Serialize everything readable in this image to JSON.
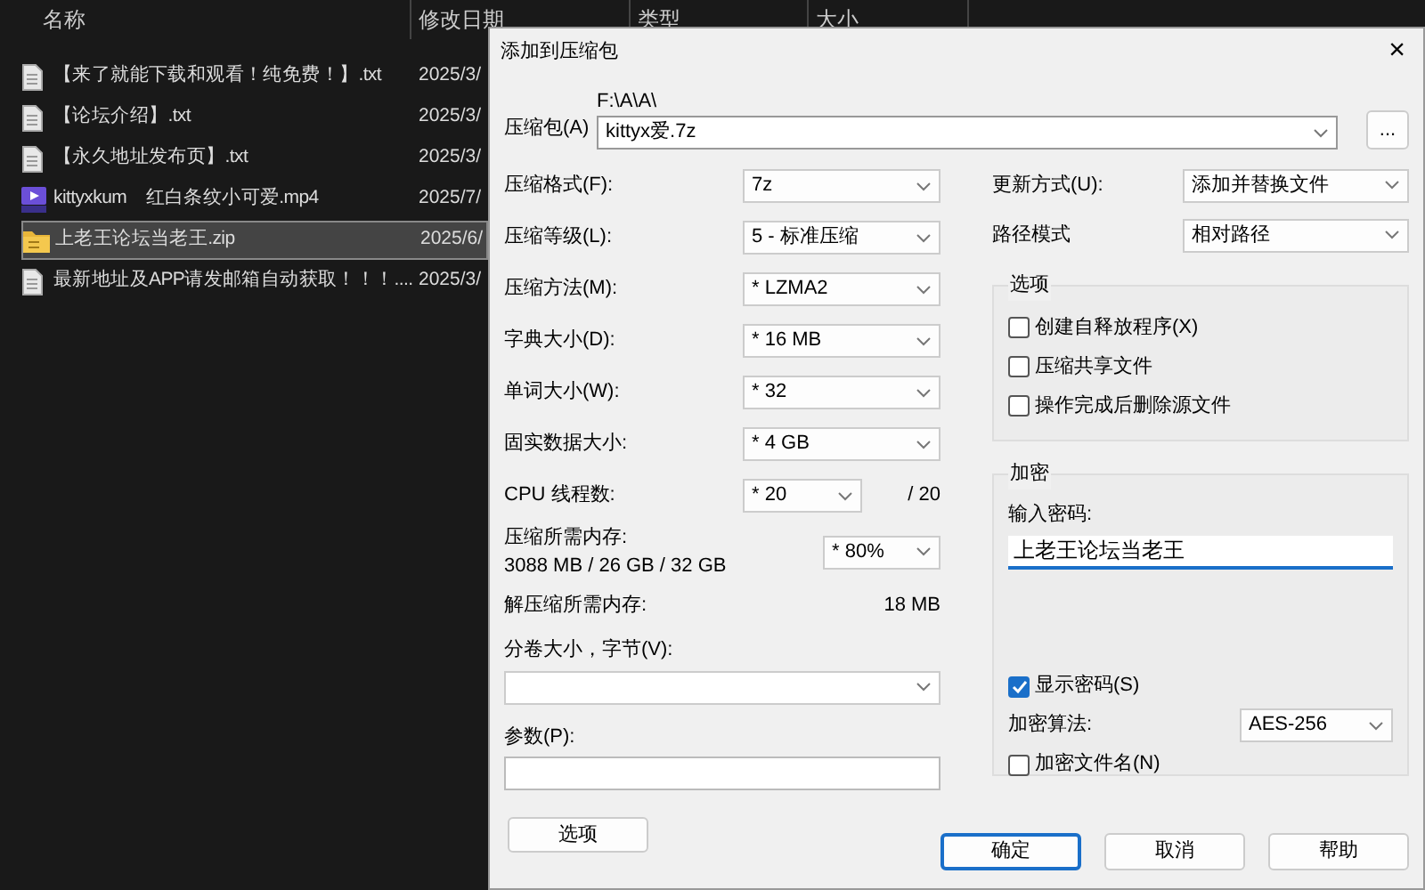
{
  "explorer": {
    "columns": [
      "名称",
      "修改日期",
      "类型",
      "大小"
    ],
    "files": [
      {
        "name": "【来了就能下载和观看！纯免费！】.txt",
        "date": "2025/3/",
        "kind": "text",
        "selected": false
      },
      {
        "name": "【论坛介绍】.txt",
        "date": "2025/3/",
        "kind": "text",
        "selected": false
      },
      {
        "name": "【永久地址发布页】.txt",
        "date": "2025/3/",
        "kind": "text",
        "selected": false
      },
      {
        "name": "kittyxkum　红白条纹小可爱.mp4",
        "date": "2025/7/",
        "kind": "video",
        "selected": false
      },
      {
        "name": "上老王论坛当老王.zip",
        "date": "2025/6/",
        "kind": "archive",
        "selected": true
      },
      {
        "name": "最新地址及APP请发邮箱自动获取！！！....",
        "date": "2025/3/",
        "kind": "text",
        "selected": false
      }
    ]
  },
  "dialog": {
    "title": "添加到压缩包",
    "close": "×",
    "archive": {
      "label": "压缩包(A)",
      "path": "F:\\A\\A\\",
      "value": "kittyx爱.7z",
      "browse": "..."
    },
    "left_rows": [
      {
        "label": "压缩格式(F):",
        "value": "7z"
      },
      {
        "label": "压缩等级(L):",
        "value": "5 - 标准压缩"
      },
      {
        "label": "压缩方法(M):",
        "value": "* LZMA2"
      },
      {
        "label": "字典大小(D):",
        "value": "* 16 MB"
      },
      {
        "label": "单词大小(W):",
        "value": "* 32"
      },
      {
        "label": "固实数据大小:",
        "value": "* 4 GB"
      }
    ],
    "cpu": {
      "label": "CPU 线程数:",
      "value": "* 20",
      "max": "/ 20"
    },
    "memory": {
      "label": "压缩所需内存:",
      "detail": "3088 MB / 26 GB / 32 GB",
      "value": "* 80%"
    },
    "decompress_memory": {
      "label": "解压缩所需内存:",
      "value": "18 MB"
    },
    "volume": {
      "label": "分卷大小，字节(V):"
    },
    "parameters": {
      "label": "参数(P):"
    },
    "options_button": "选项",
    "right_rows": [
      {
        "label": "更新方式(U):",
        "value": "添加并替换文件"
      },
      {
        "label": "路径模式",
        "value": "相对路径"
      }
    ],
    "options_group": {
      "title": "选项",
      "items": [
        {
          "label": "创建自释放程序(X)",
          "checked": false
        },
        {
          "label": "压缩共享文件",
          "checked": false
        },
        {
          "label": "操作完成后删除源文件",
          "checked": false
        }
      ]
    },
    "encryption": {
      "title": "加密",
      "password_label": "输入密码:",
      "password": "上老王论坛当老王",
      "show_password": {
        "label": "显示密码(S)",
        "checked": true
      },
      "method_label": "加密算法:",
      "method": "AES-256",
      "encrypt_names": {
        "label": "加密文件名(N)",
        "checked": false
      }
    },
    "buttons": [
      {
        "label": "确定",
        "default": true
      },
      {
        "label": "取消",
        "default": false
      },
      {
        "label": "帮助",
        "default": false
      }
    ]
  }
}
